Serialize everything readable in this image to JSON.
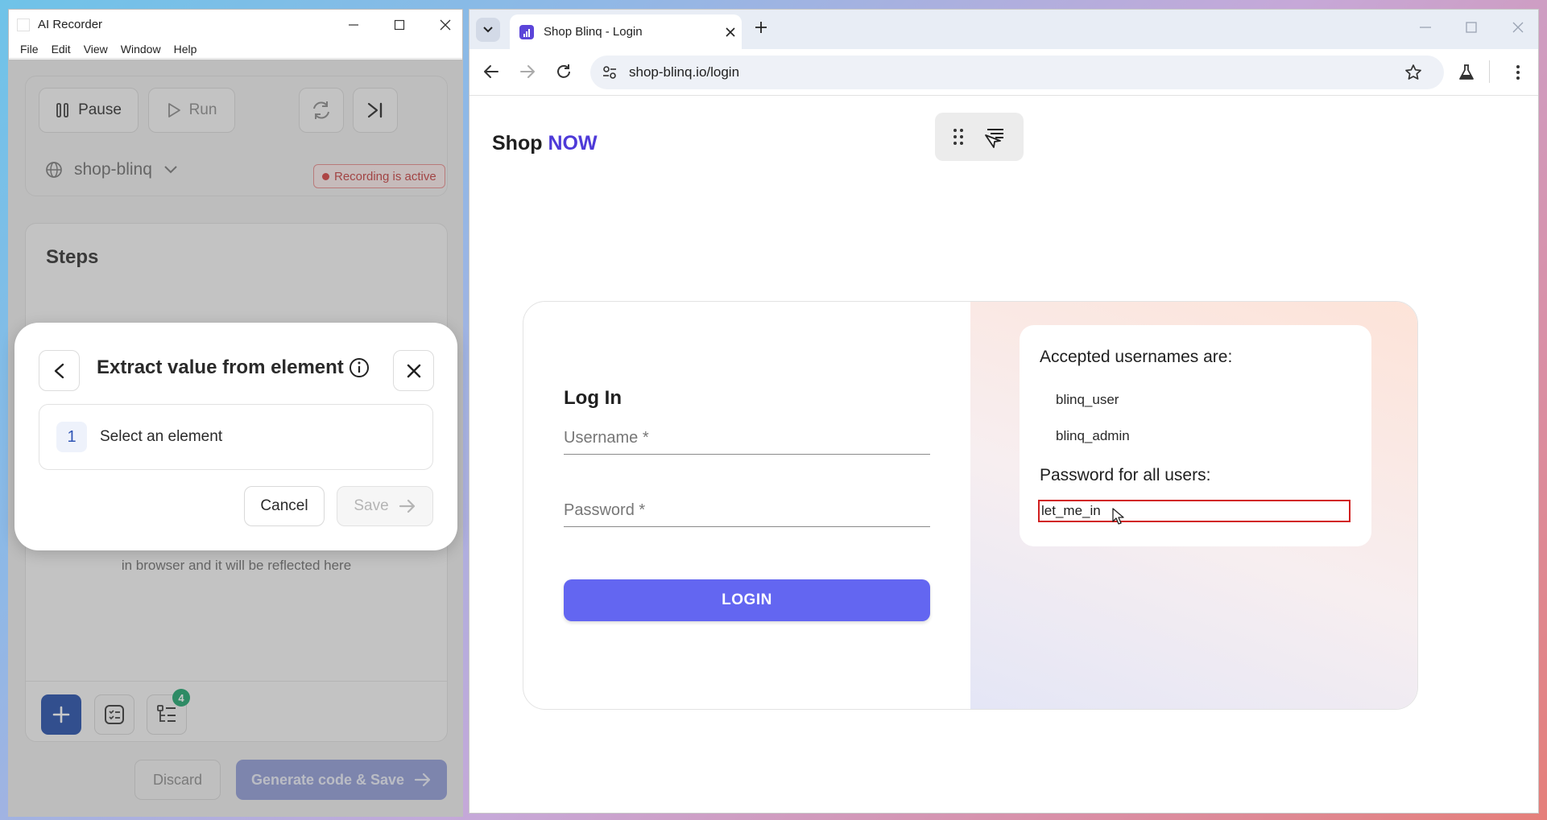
{
  "recorder": {
    "title": "AI Recorder",
    "menu": [
      "File",
      "Edit",
      "View",
      "Window",
      "Help"
    ],
    "controls": {
      "pause_label": "Pause",
      "run_label": "Run"
    },
    "project": "shop-blinq",
    "recording_status": "Recording is active",
    "steps": {
      "title": "Steps",
      "hint": "in browser and it will be reflected here",
      "badge_count": "4"
    },
    "footer": {
      "discard_label": "Discard",
      "generate_label": "Generate code & Save"
    }
  },
  "modal": {
    "title": "Extract value from element",
    "step_number": "1",
    "step_label": "Select an element",
    "cancel_label": "Cancel",
    "save_label": "Save"
  },
  "browser": {
    "tab_title": "Shop Blinq - Login",
    "url": "shop-blinq.io/login"
  },
  "page": {
    "brand_prefix": "Shop",
    "brand_highlight": "NOW",
    "login": {
      "title": "Log In",
      "username_placeholder": "Username *",
      "password_placeholder": "Password *",
      "button_label": "LOGIN"
    },
    "info": {
      "usernames_title": "Accepted usernames are:",
      "usernames": [
        "blinq_user",
        "blinq_admin"
      ],
      "password_title": "Password for all users:",
      "password_value": "let_me_in"
    }
  },
  "colors": {
    "accent_purple": "#6366f1",
    "brand_now": "#4e3ad8",
    "highlight_border": "#d11f1f",
    "add_button": "#1f4aa8",
    "badge_green": "#18a36a",
    "recording_red": "#c43a3a"
  }
}
